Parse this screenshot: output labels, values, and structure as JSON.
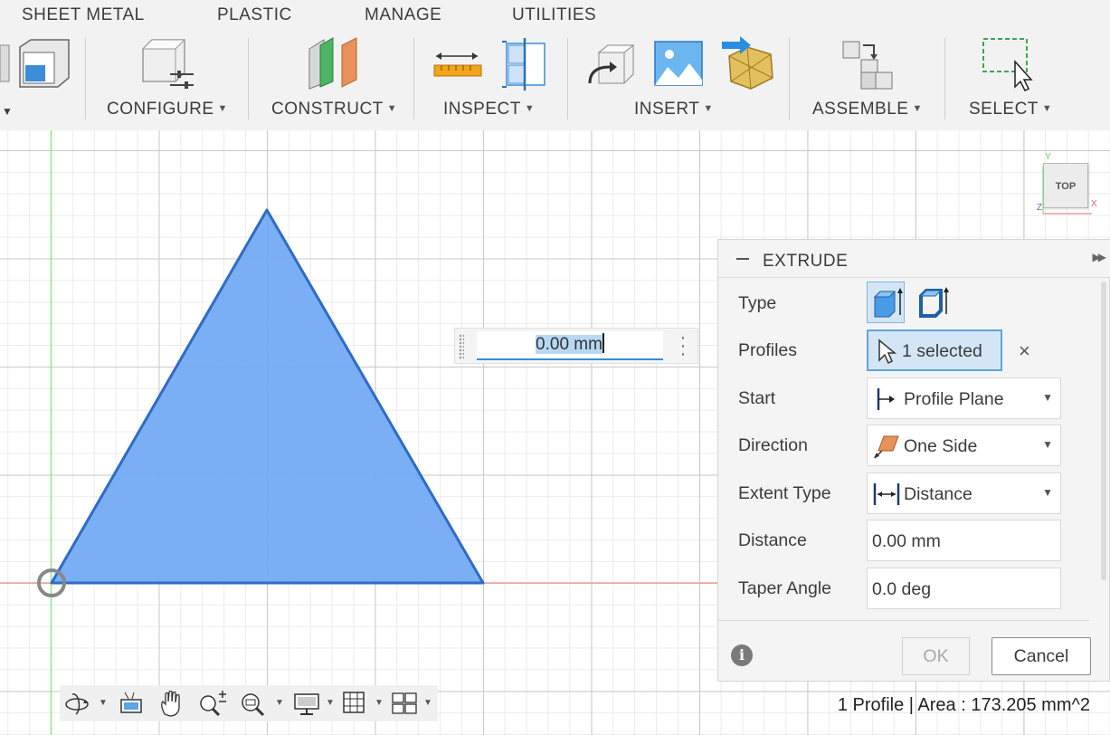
{
  "tabs": [
    "SHEET METAL",
    "PLASTIC",
    "MANAGE",
    "UTILITIES"
  ],
  "toolbar_groups": [
    {
      "label": "CONFIGURE",
      "icon": "configure-icon"
    },
    {
      "label": "CONSTRUCT",
      "icon": "construct-plane-icon"
    },
    {
      "label": "INSPECT",
      "icon": "measure-icon"
    },
    {
      "label": "INSERT",
      "icon": "insert-image-icon"
    },
    {
      "label": "ASSEMBLE",
      "icon": "joint-icon"
    },
    {
      "label": "SELECT",
      "icon": "window-select-icon"
    }
  ],
  "viewcube": {
    "label": "TOP",
    "axes": [
      "Y",
      "Z",
      "X"
    ]
  },
  "dimension_input": {
    "value": "0.00 mm"
  },
  "extrude_panel": {
    "title": "EXTRUDE",
    "rows": {
      "type": {
        "label": "Type"
      },
      "profiles": {
        "label": "Profiles",
        "value": "1 selected"
      },
      "start": {
        "label": "Start",
        "value": "Profile Plane"
      },
      "direction": {
        "label": "Direction",
        "value": "One Side"
      },
      "extent_type": {
        "label": "Extent Type",
        "value": "Distance"
      },
      "distance": {
        "label": "Distance",
        "value": "0.00 mm"
      },
      "taper_angle": {
        "label": "Taper Angle",
        "value": "0.0 deg"
      }
    },
    "ok_label": "OK",
    "cancel_label": "Cancel"
  },
  "status": "1 Profile | Area : 173.205 mm^2",
  "colors": {
    "profile_fill": "#6fa8f5",
    "profile_stroke": "#2f6bc4",
    "accent": "#3a8dd6"
  }
}
